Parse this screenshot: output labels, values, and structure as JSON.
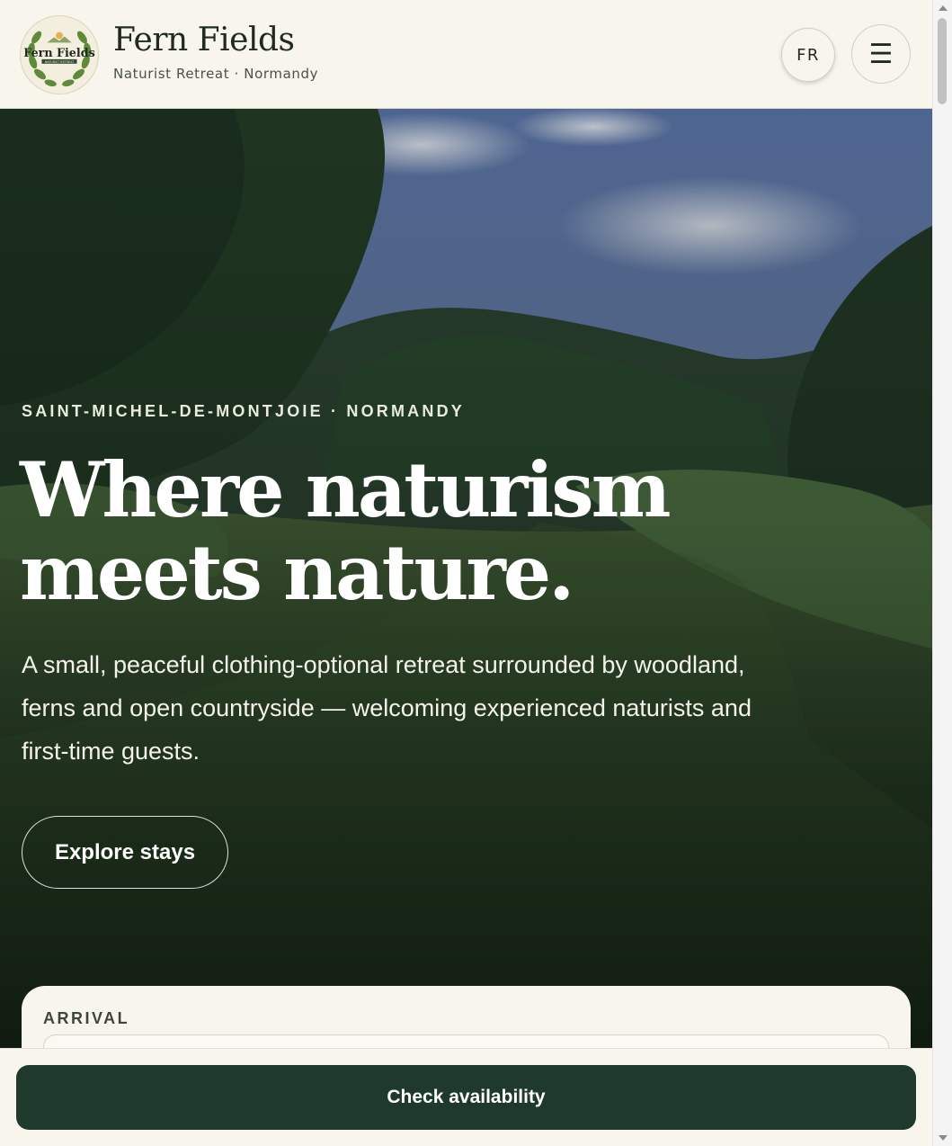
{
  "header": {
    "brand_name": "Fern Fields",
    "brand_subtitle": "Naturist Retreat · Normandy",
    "logo_text": "Fern Fields",
    "logo_subtext": "NATURIST RETREAT",
    "language_button": "FR",
    "menu_icon": "hamburger-menu-icon",
    "menu_glyph": "☰"
  },
  "hero": {
    "eyebrow": "SAINT-MICHEL-DE-MONTJOIE · NORMANDY",
    "headline_line1": "Where naturism",
    "headline_line2": "meets nature.",
    "lede": "A small, peaceful clothing-optional retreat surrounded by woodland, ferns and open countryside — welcoming experienced naturists and first-time guests.",
    "cta_label": "Explore stays"
  },
  "booking": {
    "arrival_label": "ARRIVAL",
    "arrival_value": ""
  },
  "bottom_bar": {
    "check_label": "Check availability"
  },
  "colors": {
    "page_bg": "#f8f5ec",
    "primary_dark": "#1f3a2d",
    "text_dark": "#1f2a22"
  }
}
